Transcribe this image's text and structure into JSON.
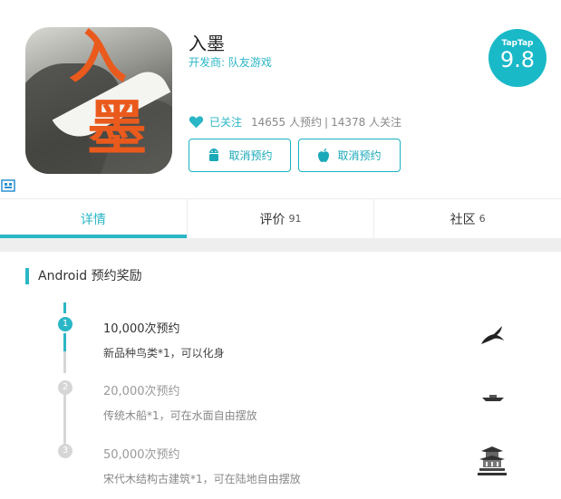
{
  "app": {
    "name": "入墨",
    "developer": "开发商: 队友游戏",
    "icon_glyph_top": "入",
    "icon_glyph_bottom": "墨"
  },
  "rating": {
    "brand": "TapTap",
    "score": "9.8"
  },
  "stats": {
    "followed_label": "已关注",
    "reservations": "14655 人预约",
    "separator": "|",
    "followers": "14378 人关注"
  },
  "buttons": {
    "android_cancel": "取消预约",
    "ios_cancel": "取消预约"
  },
  "tabs": [
    {
      "label": "详情",
      "count": ""
    },
    {
      "label": "评价",
      "count": "91"
    },
    {
      "label": "社区",
      "count": "6"
    }
  ],
  "rewards_section": {
    "title": "Android 预约奖励",
    "items": [
      {
        "step": "1",
        "title": "10,000次预约",
        "desc": "新品种鸟类*1，可以化身",
        "icon": "swallow-bird-icon",
        "achieved": true
      },
      {
        "step": "2",
        "title": "20,000次预约",
        "desc": "传统木船*1，可在水面自由摆放",
        "icon": "wooden-boat-icon",
        "achieved": false
      },
      {
        "step": "3",
        "title": "50,000次预约",
        "desc": "宋代木结构古建筑*1，可在陆地自由摆放",
        "icon": "ancient-building-icon",
        "achieved": false
      }
    ]
  },
  "colors": {
    "accent": "#2bb6c6",
    "badge": "#19b9c8",
    "icon_orange": "#ea5a1d",
    "inactive": "#d6d6d6"
  }
}
